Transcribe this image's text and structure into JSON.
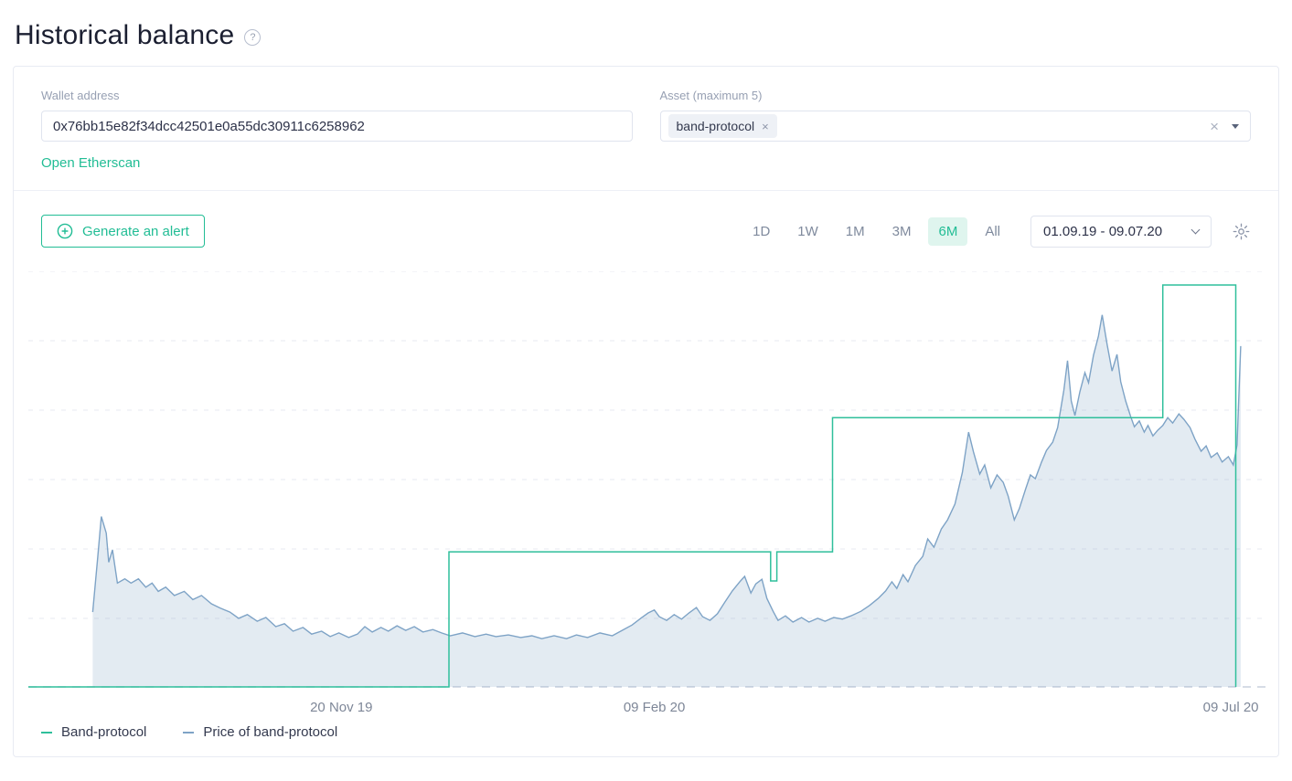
{
  "page": {
    "title": "Historical balance",
    "help_icon": "?"
  },
  "filters": {
    "wallet": {
      "label": "Wallet address",
      "value": "0x76bb15e82f34dcc42501e0a55dc30911c6258962",
      "link": "Open Etherscan"
    },
    "asset": {
      "label": "Asset (maximum 5)",
      "chip": "band-protocol",
      "chip_remove": "×",
      "clear": "×"
    }
  },
  "toolbar": {
    "generate_alert": "Generate an alert",
    "ranges": [
      "1D",
      "1W",
      "1M",
      "3M",
      "6M",
      "All"
    ],
    "active_range": "6M",
    "date_range": "01.09.19 - 09.07.20"
  },
  "legend": [
    {
      "label": "Band-protocol",
      "color": "#2fbf9b"
    },
    {
      "label": "Price of band-protocol",
      "color": "#7ea3c6"
    }
  ],
  "colors": {
    "accent": "#22bd95",
    "accent_bg": "#dff5ee",
    "price_line": "#7ea3c6",
    "price_fill": "#7ea3c6",
    "grid": "#e7eaf2",
    "axis": "#c9d0dd",
    "tick_text": "#7e8798"
  },
  "chart_data": {
    "type": "line",
    "title": "Historical balance of band-protocol vs price",
    "x_range": [
      "01.09.19",
      "09.07.20"
    ],
    "x_ticks": [
      {
        "label": "20 Nov 19",
        "t": 0.253,
        "align": "middle"
      },
      {
        "label": "09 Feb 20",
        "t": 0.506,
        "align": "middle"
      },
      {
        "label": "09 Jul 20",
        "t": 0.972,
        "align": "middle"
      }
    ],
    "y_axis": "no y-axis labels shown; values normalized 0-1 of plot height",
    "grid": "horizontal-dashed",
    "legend_position": "bottom-left",
    "grid_color": "#e7eaf2",
    "axis_color": "#c9d0dd",
    "series": [
      {
        "name": "Band-protocol",
        "style": "step",
        "color": "#2fbf9b",
        "points": [
          [
            0.0,
            0.0
          ],
          [
            0.34,
            0.0
          ],
          [
            0.34,
            0.325
          ],
          [
            0.6,
            0.325
          ],
          [
            0.6,
            0.255
          ],
          [
            0.605,
            0.255
          ],
          [
            0.605,
            0.325
          ],
          [
            0.65,
            0.325
          ],
          [
            0.65,
            0.648
          ],
          [
            0.917,
            0.648
          ],
          [
            0.917,
            0.967
          ],
          [
            0.976,
            0.967
          ],
          [
            0.976,
            0.0
          ]
        ]
      },
      {
        "name": "Price of band-protocol",
        "style": "area",
        "color": "#7ea3c6",
        "fill_opacity": 0.22,
        "points": [
          [
            0.052,
            0.18
          ],
          [
            0.056,
            0.31
          ],
          [
            0.059,
            0.41
          ],
          [
            0.063,
            0.37
          ],
          [
            0.065,
            0.3
          ],
          [
            0.068,
            0.33
          ],
          [
            0.072,
            0.25
          ],
          [
            0.078,
            0.26
          ],
          [
            0.083,
            0.25
          ],
          [
            0.089,
            0.26
          ],
          [
            0.095,
            0.24
          ],
          [
            0.1,
            0.25
          ],
          [
            0.105,
            0.23
          ],
          [
            0.111,
            0.24
          ],
          [
            0.118,
            0.22
          ],
          [
            0.126,
            0.23
          ],
          [
            0.133,
            0.21
          ],
          [
            0.14,
            0.22
          ],
          [
            0.148,
            0.2
          ],
          [
            0.155,
            0.19
          ],
          [
            0.163,
            0.18
          ],
          [
            0.17,
            0.165
          ],
          [
            0.177,
            0.174
          ],
          [
            0.185,
            0.158
          ],
          [
            0.192,
            0.167
          ],
          [
            0.2,
            0.145
          ],
          [
            0.207,
            0.152
          ],
          [
            0.214,
            0.134
          ],
          [
            0.222,
            0.143
          ],
          [
            0.229,
            0.127
          ],
          [
            0.237,
            0.134
          ],
          [
            0.244,
            0.121
          ],
          [
            0.251,
            0.13
          ],
          [
            0.259,
            0.119
          ],
          [
            0.266,
            0.127
          ],
          [
            0.272,
            0.145
          ],
          [
            0.278,
            0.132
          ],
          [
            0.285,
            0.143
          ],
          [
            0.291,
            0.134
          ],
          [
            0.298,
            0.147
          ],
          [
            0.305,
            0.136
          ],
          [
            0.312,
            0.145
          ],
          [
            0.319,
            0.132
          ],
          [
            0.327,
            0.138
          ],
          [
            0.334,
            0.13
          ],
          [
            0.341,
            0.123
          ],
          [
            0.351,
            0.13
          ],
          [
            0.361,
            0.121
          ],
          [
            0.37,
            0.127
          ],
          [
            0.378,
            0.121
          ],
          [
            0.388,
            0.125
          ],
          [
            0.398,
            0.119
          ],
          [
            0.407,
            0.123
          ],
          [
            0.415,
            0.116
          ],
          [
            0.425,
            0.123
          ],
          [
            0.435,
            0.116
          ],
          [
            0.443,
            0.125
          ],
          [
            0.452,
            0.119
          ],
          [
            0.462,
            0.13
          ],
          [
            0.472,
            0.123
          ],
          [
            0.48,
            0.136
          ],
          [
            0.488,
            0.149
          ],
          [
            0.495,
            0.165
          ],
          [
            0.501,
            0.178
          ],
          [
            0.506,
            0.185
          ],
          [
            0.51,
            0.169
          ],
          [
            0.516,
            0.16
          ],
          [
            0.522,
            0.174
          ],
          [
            0.528,
            0.163
          ],
          [
            0.534,
            0.178
          ],
          [
            0.54,
            0.191
          ],
          [
            0.545,
            0.169
          ],
          [
            0.551,
            0.16
          ],
          [
            0.557,
            0.176
          ],
          [
            0.563,
            0.204
          ],
          [
            0.569,
            0.231
          ],
          [
            0.575,
            0.253
          ],
          [
            0.579,
            0.266
          ],
          [
            0.584,
            0.226
          ],
          [
            0.588,
            0.248
          ],
          [
            0.593,
            0.259
          ],
          [
            0.597,
            0.213
          ],
          [
            0.602,
            0.182
          ],
          [
            0.606,
            0.16
          ],
          [
            0.612,
            0.171
          ],
          [
            0.618,
            0.156
          ],
          [
            0.625,
            0.167
          ],
          [
            0.631,
            0.156
          ],
          [
            0.638,
            0.165
          ],
          [
            0.644,
            0.158
          ],
          [
            0.651,
            0.167
          ],
          [
            0.658,
            0.163
          ],
          [
            0.665,
            0.171
          ],
          [
            0.673,
            0.182
          ],
          [
            0.68,
            0.196
          ],
          [
            0.687,
            0.213
          ],
          [
            0.693,
            0.231
          ],
          [
            0.698,
            0.253
          ],
          [
            0.702,
            0.237
          ],
          [
            0.707,
            0.27
          ],
          [
            0.711,
            0.253
          ],
          [
            0.717,
            0.292
          ],
          [
            0.723,
            0.314
          ],
          [
            0.727,
            0.356
          ],
          [
            0.732,
            0.336
          ],
          [
            0.738,
            0.38
          ],
          [
            0.743,
            0.402
          ],
          [
            0.749,
            0.44
          ],
          [
            0.755,
            0.516
          ],
          [
            0.76,
            0.613
          ],
          [
            0.764,
            0.565
          ],
          [
            0.769,
            0.512
          ],
          [
            0.773,
            0.534
          ],
          [
            0.778,
            0.479
          ],
          [
            0.783,
            0.51
          ],
          [
            0.788,
            0.492
          ],
          [
            0.792,
            0.459
          ],
          [
            0.797,
            0.402
          ],
          [
            0.801,
            0.429
          ],
          [
            0.806,
            0.475
          ],
          [
            0.81,
            0.51
          ],
          [
            0.814,
            0.501
          ],
          [
            0.819,
            0.541
          ],
          [
            0.823,
            0.569
          ],
          [
            0.828,
            0.589
          ],
          [
            0.832,
            0.624
          ],
          [
            0.837,
            0.714
          ],
          [
            0.84,
            0.785
          ],
          [
            0.843,
            0.688
          ],
          [
            0.846,
            0.653
          ],
          [
            0.85,
            0.71
          ],
          [
            0.854,
            0.756
          ],
          [
            0.857,
            0.732
          ],
          [
            0.861,
            0.798
          ],
          [
            0.865,
            0.844
          ],
          [
            0.868,
            0.895
          ],
          [
            0.872,
            0.824
          ],
          [
            0.876,
            0.76
          ],
          [
            0.88,
            0.8
          ],
          [
            0.883,
            0.734
          ],
          [
            0.887,
            0.688
          ],
          [
            0.891,
            0.651
          ],
          [
            0.894,
            0.626
          ],
          [
            0.898,
            0.64
          ],
          [
            0.902,
            0.613
          ],
          [
            0.905,
            0.629
          ],
          [
            0.909,
            0.604
          ],
          [
            0.913,
            0.618
          ],
          [
            0.917,
            0.629
          ],
          [
            0.921,
            0.648
          ],
          [
            0.925,
            0.635
          ],
          [
            0.93,
            0.657
          ],
          [
            0.934,
            0.644
          ],
          [
            0.939,
            0.624
          ],
          [
            0.943,
            0.596
          ],
          [
            0.948,
            0.567
          ],
          [
            0.952,
            0.58
          ],
          [
            0.956,
            0.552
          ],
          [
            0.961,
            0.563
          ],
          [
            0.965,
            0.541
          ],
          [
            0.97,
            0.554
          ],
          [
            0.974,
            0.534
          ],
          [
            0.977,
            0.582
          ],
          [
            0.98,
            0.82
          ]
        ]
      }
    ]
  }
}
